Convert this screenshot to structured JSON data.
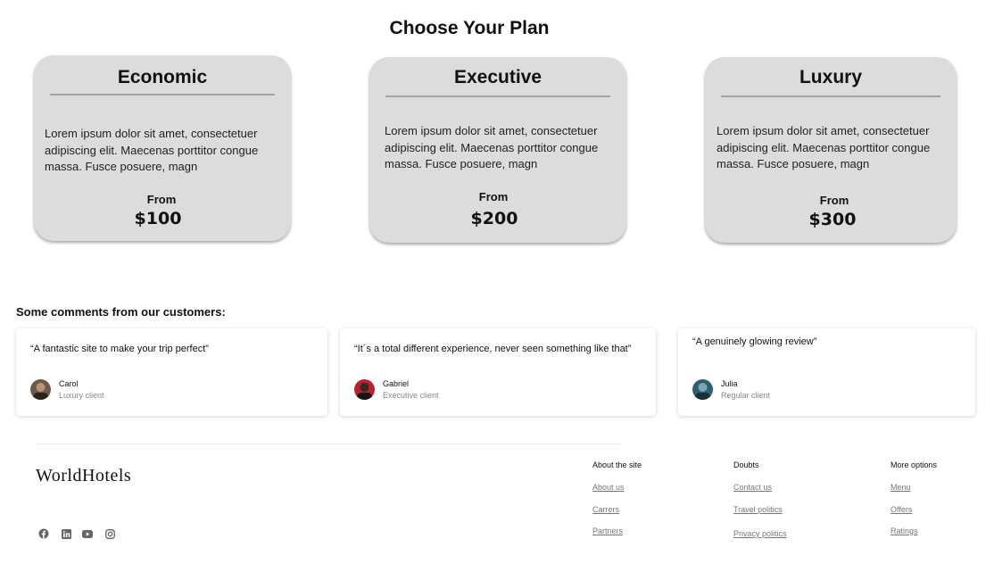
{
  "page": {
    "title": "Choose Your Plan"
  },
  "plans": [
    {
      "name": "Economic",
      "description": "Lorem ipsum dolor sit amet, consectetuer adipiscing elit. Maecenas porttitor congue massa. Fusce posuere, magn",
      "from_label": "From",
      "price": "$100"
    },
    {
      "name": "Executive",
      "description": "Lorem ipsum dolor sit amet, consectetuer adipiscing elit. Maecenas porttitor congue massa. Fusce posuere, magn",
      "from_label": "From",
      "price": "$200"
    },
    {
      "name": "Luxury",
      "description": "Lorem ipsum dolor sit amet, consectetuer adipiscing elit. Maecenas porttitor congue massa. Fusce posuere, magn",
      "from_label": "From",
      "price": "$300"
    }
  ],
  "comments": {
    "heading": "Some comments from our customers:",
    "items": [
      {
        "quote": "“A fantastic site to make your trip perfect”",
        "name": "Carol",
        "role": "Luxury client",
        "avatar_color": "#5a4a3a"
      },
      {
        "quote": "“It´s a total different experience, never seen something like that”",
        "name": "Gabriel",
        "role": "Executive client",
        "avatar_color": "#b8222a"
      },
      {
        "quote": "“A genuinely glowing review”",
        "name": "Julia",
        "role": "Regular client",
        "avatar_color": "#2e5f6e"
      }
    ]
  },
  "footer": {
    "brand": "WorldHotels",
    "social_icons": [
      "facebook-icon",
      "linkedin-icon",
      "youtube-icon",
      "instagram-icon"
    ],
    "columns": [
      {
        "title": "About the site",
        "links": [
          "About us",
          "Carrers",
          "Partners"
        ]
      },
      {
        "title": "Doubts",
        "links": [
          "Contact us",
          "Travel politics",
          "Privacy politics"
        ]
      },
      {
        "title": "More options",
        "links": [
          "Menu",
          "Offers",
          "Ratings"
        ]
      }
    ]
  },
  "colors": {
    "card_bg": "#dcdcdc",
    "divider": "#a3a3a3",
    "muted_text": "#888888"
  }
}
